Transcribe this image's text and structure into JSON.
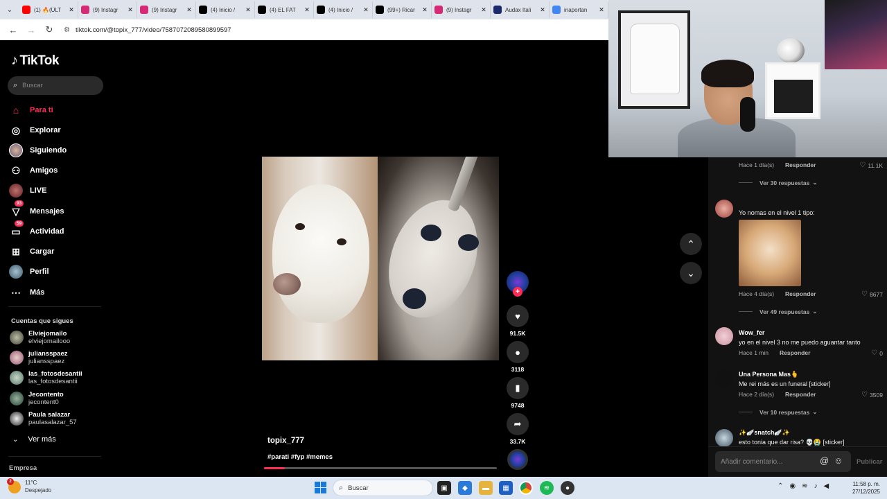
{
  "browser": {
    "tabs": [
      {
        "label": "(1) 🔥(ÚLT",
        "favicon": "youtube-icon",
        "color": "#ff0000"
      },
      {
        "label": "(9) Instagr",
        "favicon": "instagram-icon",
        "color": "#d62976"
      },
      {
        "label": "(9) Instagr",
        "favicon": "instagram-icon",
        "color": "#d62976"
      },
      {
        "label": "(4) Inicio /",
        "favicon": "x-icon",
        "color": "#000000"
      },
      {
        "label": "(4) EL FAT",
        "favicon": "x-icon",
        "color": "#000000"
      },
      {
        "label": "(4) Inicio /",
        "favicon": "x-icon",
        "color": "#000000"
      },
      {
        "label": "(99+) Ricar",
        "favicon": "tiktok-icon",
        "color": "#000000"
      },
      {
        "label": "(9) Instagr",
        "favicon": "instagram-icon",
        "color": "#d62976"
      },
      {
        "label": "Audax Itali",
        "favicon": "audax-icon",
        "color": "#1a2a6c"
      },
      {
        "label": "inaportan",
        "favicon": "google-icon",
        "color": "#4285f4"
      }
    ],
    "url": "tiktok.com/@topix_777/video/7587072089580899597"
  },
  "tiktok": {
    "logo": "TikTok",
    "search_placeholder": "Buscar",
    "nav": [
      {
        "label": "Para ti",
        "icon": "home-icon",
        "active": true
      },
      {
        "label": "Explorar",
        "icon": "compass-icon"
      },
      {
        "label": "Siguiendo",
        "icon": "following-avatar-icon"
      },
      {
        "label": "Amigos",
        "icon": "friends-icon"
      },
      {
        "label": "LIVE",
        "icon": "live-icon"
      },
      {
        "label": "Mensajes",
        "icon": "messages-icon",
        "badge": "93"
      },
      {
        "label": "Actividad",
        "icon": "activity-icon",
        "badge": "59"
      },
      {
        "label": "Cargar",
        "icon": "upload-icon"
      },
      {
        "label": "Perfil",
        "icon": "profile-icon"
      },
      {
        "label": "Más",
        "icon": "more-icon"
      }
    ],
    "following_title": "Cuentas que sigues",
    "following": [
      {
        "name": "Elviejomailo",
        "user": "elviejomailooo"
      },
      {
        "name": "juliansspaez",
        "user": "juliansspaez"
      },
      {
        "name": "las_fotosdesantii",
        "user": "las_fotosdesantii"
      },
      {
        "name": "Jecontento",
        "user": "jecontent0"
      },
      {
        "name": "Paula salazar",
        "user": "paulasalazar_57"
      }
    ],
    "ver_mas": "Ver más",
    "empresa": "Empresa",
    "video": {
      "author": "topix_777",
      "tags": "#parati #fyp #memes",
      "progress": 0.09,
      "likes": "91.5K",
      "comments": "3118",
      "saves": "9748",
      "shares": "33.7K"
    }
  },
  "comments": {
    "items": [
      {
        "meta_time": "Hace 1 día(s)",
        "reply": "Responder",
        "likes": "11.1K",
        "replies": "Ver 30 respuestas"
      },
      {
        "text": "Yo nomas en el nivel 1 tipo:",
        "meta_time": "Hace 4 día(s)",
        "reply": "Responder",
        "likes": "8677",
        "replies": "Ver 49 respuestas"
      },
      {
        "name": "Wow_fer",
        "text": "yo en el nivel 3 no me puedo aguantar tanto",
        "meta_time": "Hace 1 min",
        "reply": "Responder",
        "likes": "0"
      },
      {
        "name": "Una Persona Mas🫰",
        "text": "Me rei más es un funeral [sticker]",
        "meta_time": "Hace 2 día(s)",
        "reply": "Responder",
        "likes": "3509",
        "replies": "Ver 10 respuestas"
      },
      {
        "name": "✨🪽snatch🪽✨",
        "text": "esto tonia que dar risa? 💀😭 [sticker]"
      }
    ],
    "compose_placeholder": "Añadir comentario...",
    "publish": "Publicar"
  },
  "taskbar": {
    "weather_temp": "11°C",
    "weather_desc": "Despejado",
    "weather_badge": "2",
    "search": "Buscar",
    "time": "11:58 p. m.",
    "date": "27/12/2025"
  }
}
